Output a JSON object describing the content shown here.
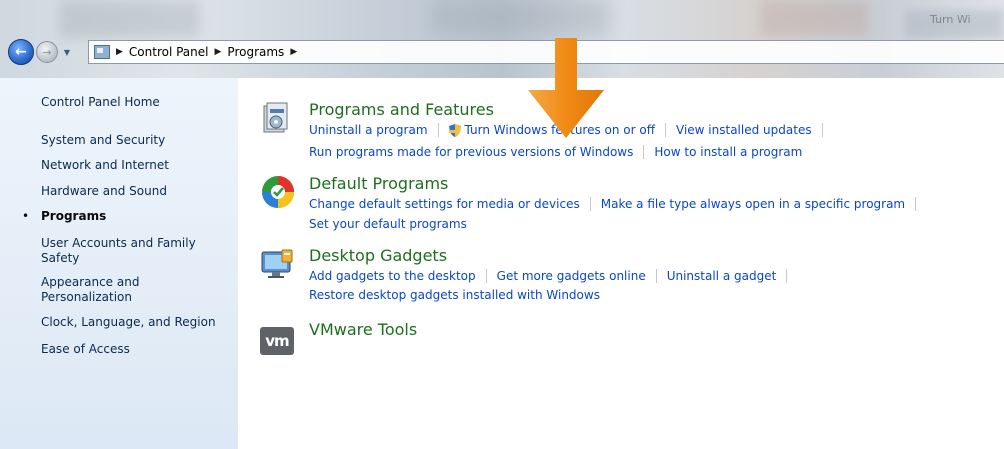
{
  "window": {
    "background_title_fragment": "Turn Wi"
  },
  "address_bar": {
    "crumbs": [
      "Control Panel",
      "Programs"
    ]
  },
  "left_nav": {
    "items": [
      {
        "label": "Control Panel Home",
        "current": false
      },
      {
        "label": "System and Security",
        "current": false
      },
      {
        "label": "Network and Internet",
        "current": false
      },
      {
        "label": "Hardware and Sound",
        "current": false
      },
      {
        "label": "Programs",
        "current": true
      },
      {
        "label": "User Accounts and Family Safety",
        "current": false
      },
      {
        "label": "Appearance and Personalization",
        "current": false
      },
      {
        "label": "Clock, Language, and Region",
        "current": false
      },
      {
        "label": "Ease of Access",
        "current": false
      }
    ]
  },
  "categories": {
    "programs_features": {
      "title": "Programs and Features",
      "icon": "programs-features-icon",
      "row1": [
        "Uninstall a program",
        "Turn Windows features on or off",
        "View installed updates"
      ],
      "row2": [
        "Run programs made for previous versions of Windows",
        "How to install a program"
      ]
    },
    "default_programs": {
      "title": "Default Programs",
      "icon": "default-programs-icon",
      "row1": [
        "Change default settings for media or devices",
        "Make a file type always open in a specific program"
      ],
      "row2": [
        "Set your default programs"
      ]
    },
    "desktop_gadgets": {
      "title": "Desktop Gadgets",
      "icon": "desktop-gadgets-icon",
      "row1": [
        "Add gadgets to the desktop",
        "Get more gadgets online",
        "Uninstall a gadget"
      ],
      "row2": [
        "Restore desktop gadgets installed with Windows"
      ]
    },
    "vmware_tools": {
      "title": "VMware Tools",
      "icon": "vmware-icon",
      "icon_text": "vm"
    }
  },
  "colors": {
    "title_green": "#1e6e1e",
    "link_blue": "#0b47c2",
    "nav_bg": "#e4edf7",
    "arrow_orange": "#f5901e"
  }
}
